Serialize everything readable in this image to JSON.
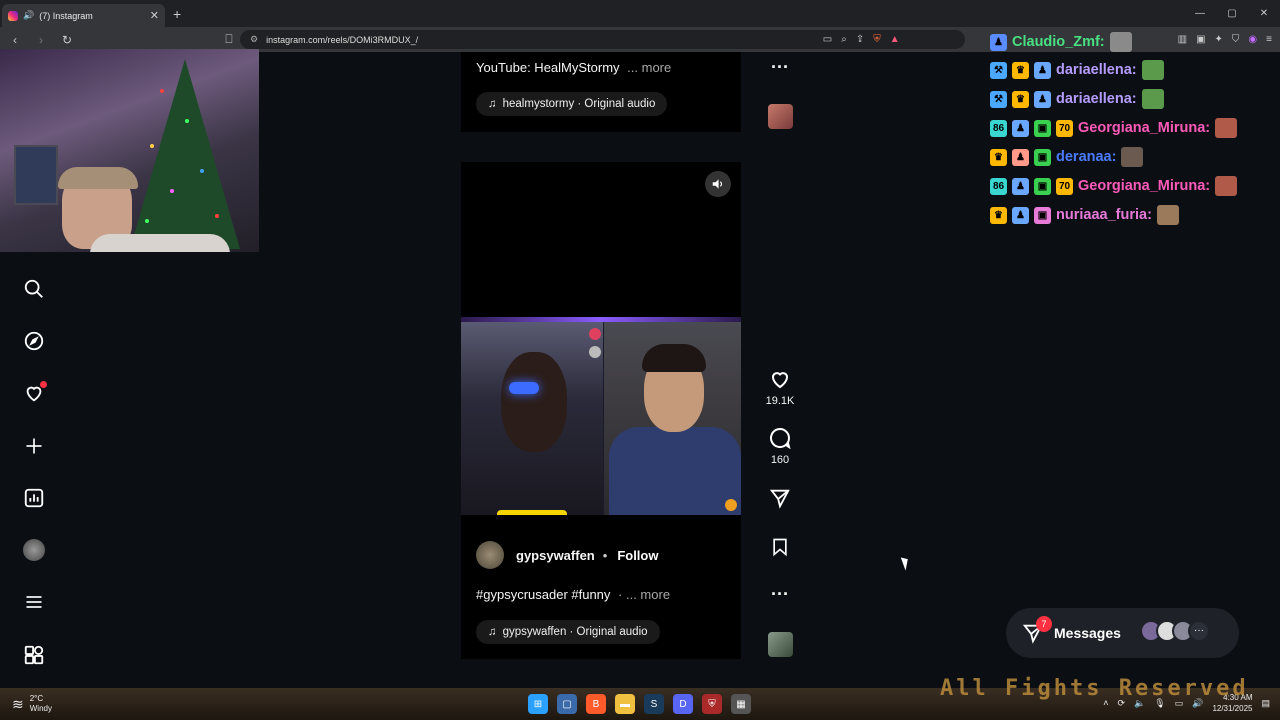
{
  "browser": {
    "tab_title": "(7) Instagram",
    "url": "instagram.com/reels/DOMi3RMDUX_/",
    "window_controls": [
      "—",
      "▢",
      "✕"
    ]
  },
  "previous_reel": {
    "caption": "YouTube: HealMyStormy",
    "more_label": "... more",
    "audio": "healmystormy · Original audio"
  },
  "current_reel": {
    "author": "gypsywaffen",
    "separator": "•",
    "follow_label": "Follow",
    "caption": "#gypsycrusader #funny",
    "more_label": "· ... more",
    "audio": "gypsywaffen · Original audio",
    "likes": "19.1K",
    "comments": "160"
  },
  "chat": {
    "lines": [
      {
        "user": "Claudio_Zmf:",
        "color": "#48e080"
      },
      {
        "user": "dariaellena:",
        "color": "#b59cff"
      },
      {
        "user": "dariaellena:",
        "color": "#b59cff"
      },
      {
        "user": "Georgiana_Miruna:",
        "color": "#ff5ab8"
      },
      {
        "user": "deranaa:",
        "color": "#4a7bff"
      },
      {
        "user": "Georgiana_Miruna:",
        "color": "#ff5ab8"
      },
      {
        "user": "nuriaaa_furia:",
        "color": "#e57ad8"
      }
    ]
  },
  "messages": {
    "label": "Messages",
    "badge_count": "7"
  },
  "taskbar": {
    "temperature": "2°C",
    "weather": "Windy",
    "time": "4:30 AM",
    "date": "12/31/2025",
    "banner": "All Fights Reserved"
  },
  "colors": {
    "accent_red": "#ff3040",
    "page_bg": "#0b0f14"
  }
}
